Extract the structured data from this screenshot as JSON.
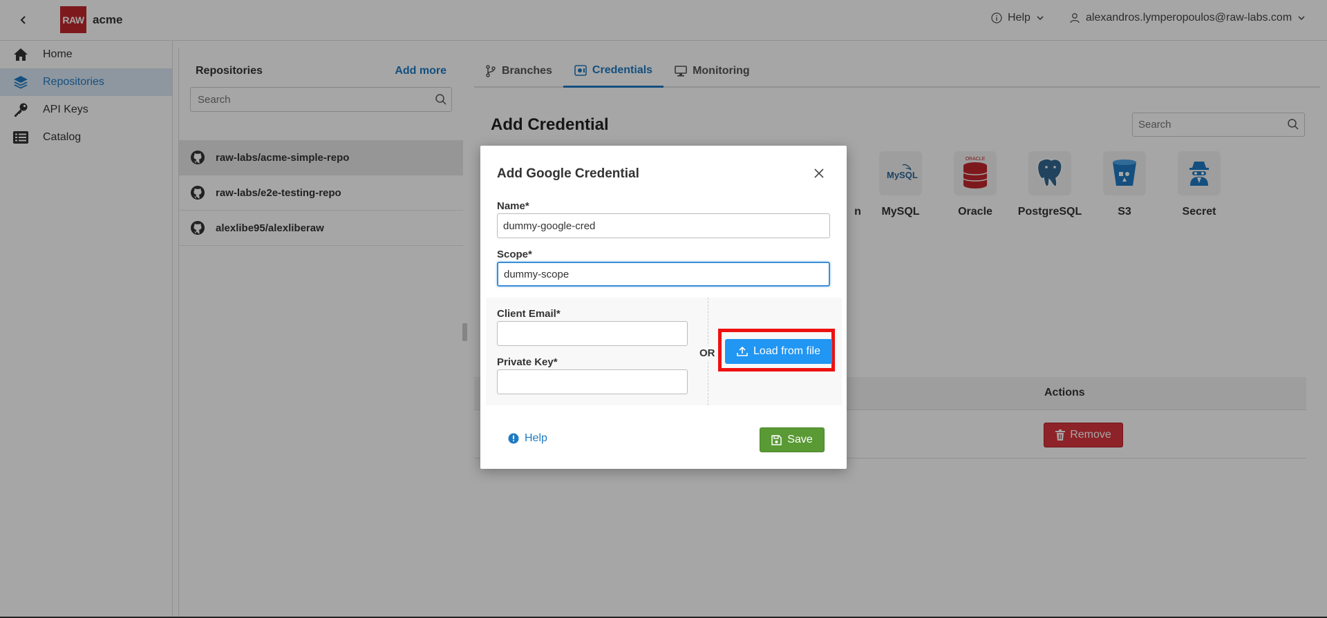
{
  "header": {
    "logo_text": "RAW",
    "org_name": "acme",
    "help_label": "Help",
    "user_email": "alexandros.lymperopoulos@raw-labs.com"
  },
  "sidebar": {
    "items": [
      {
        "label": "Home",
        "icon": "home-icon"
      },
      {
        "label": "Repositories",
        "icon": "layers-icon",
        "active": true
      },
      {
        "label": "API Keys",
        "icon": "key-icon"
      },
      {
        "label": "Catalog",
        "icon": "list-icon"
      }
    ]
  },
  "repositories": {
    "title": "Repositories",
    "add_more": "Add more",
    "search_placeholder": "Search",
    "items": [
      {
        "name": "raw-labs/acme-simple-repo",
        "active": true
      },
      {
        "name": "raw-labs/e2e-testing-repo"
      },
      {
        "name": "alexlibe95/alexliberaw"
      }
    ]
  },
  "tabs": [
    {
      "label": "Branches",
      "icon": "branch-icon"
    },
    {
      "label": "Credentials",
      "icon": "credentials-icon",
      "active": true
    },
    {
      "label": "Monitoring",
      "icon": "monitor-icon"
    }
  ],
  "credentials": {
    "title": "Add Credential",
    "search_placeholder": "Search",
    "types": [
      {
        "label": "n"
      },
      {
        "label": "MySQL",
        "logo_text": "MySQL"
      },
      {
        "label": "Oracle",
        "logo_text": "ORACLE"
      },
      {
        "label": "PostgreSQL"
      },
      {
        "label": "S3"
      },
      {
        "label": "Secret"
      }
    ],
    "table": {
      "actions_header": "Actions",
      "remove_label": "Remove"
    }
  },
  "modal": {
    "title": "Add Google Credential",
    "name_label": "Name*",
    "name_value": "dummy-google-cred",
    "scope_label": "Scope*",
    "scope_value": "dummy-scope",
    "client_email_label": "Client Email*",
    "client_email_value": "",
    "private_key_label": "Private Key*",
    "private_key_value": "",
    "or_label": "OR",
    "load_button": "Load from file",
    "help_label": "Help",
    "save_button": "Save"
  },
  "colors": {
    "accent": "#1f7ac4",
    "load_button": "#2196f3",
    "save_button": "#5a9a35",
    "remove_button": "#d9363e",
    "highlight": "#ee1111",
    "logo": "#c0272d"
  }
}
